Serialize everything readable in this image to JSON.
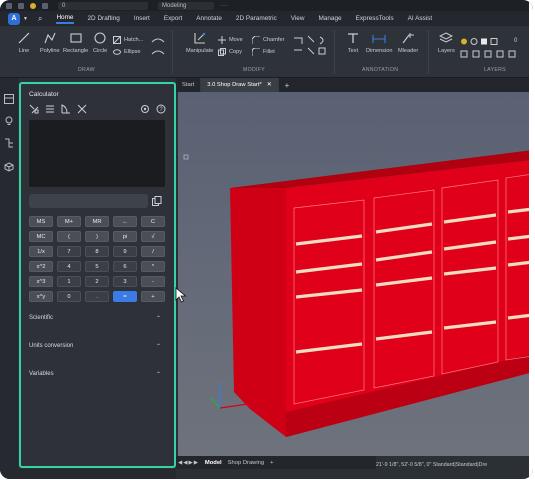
{
  "titlebar": {
    "field_value": "0",
    "workspace": "Modeling"
  },
  "menubar": {
    "logo": "A",
    "tabs": [
      "Home",
      "2D Drafting",
      "Insert",
      "Export",
      "Annotate",
      "2D Parametric",
      "View",
      "Manage",
      "ExpressTools",
      "AI Assist"
    ],
    "active_tab": "Home"
  },
  "ribbon": {
    "draw": {
      "line": "Line",
      "polyline": "Polyline",
      "rectangle": "Rectangle",
      "circle": "Circle",
      "hatch": "Hatch...",
      "ellipse": "Ellipse",
      "group": "DRAW"
    },
    "modify": {
      "manipulate": "Manipulate",
      "move": "Move",
      "copy": "Copy",
      "chamfer": "Chamfer",
      "fillet": "Fillet",
      "group": "MODIFY"
    },
    "annotation": {
      "text": "Text",
      "dimension": "Dimension",
      "mleader": "Mleader",
      "group": "ANNOTATION"
    },
    "layers": {
      "layers": "Layers",
      "layer_value": "0",
      "group": "LAYERS"
    }
  },
  "doc_tabs": [
    {
      "label": "Start",
      "active": false
    },
    {
      "label": "3.0 Shop Draw Start*",
      "active": true
    }
  ],
  "calculator": {
    "title": "Calculator",
    "keys": [
      [
        "MS",
        "M+",
        "MR",
        "←",
        "C"
      ],
      [
        "MC",
        "(",
        ")",
        "pi",
        "√"
      ],
      [
        "1/x",
        "7",
        "8",
        "9",
        "/"
      ],
      [
        "x^2",
        "4",
        "5",
        "6",
        "*"
      ],
      [
        "x^3",
        "1",
        "2",
        "3",
        "-"
      ],
      [
        "x^y",
        "0",
        ".",
        "=",
        "+"
      ]
    ],
    "sections": [
      "Scientific",
      "Units conversion",
      "Variables"
    ]
  },
  "layout_tabs": {
    "model": "Model",
    "shop": "Shop Drawing"
  },
  "status": {
    "coords": "21'-9 1/8\", 52'-0 5/8\", 0\"",
    "style1": "Standard",
    "style2": "Standard",
    "style3": "Dre"
  },
  "colors": {
    "accent": "#35d4a8",
    "brand": "#2f6fd8",
    "model_red": "#d8001a",
    "equals": "#3b7be6"
  }
}
